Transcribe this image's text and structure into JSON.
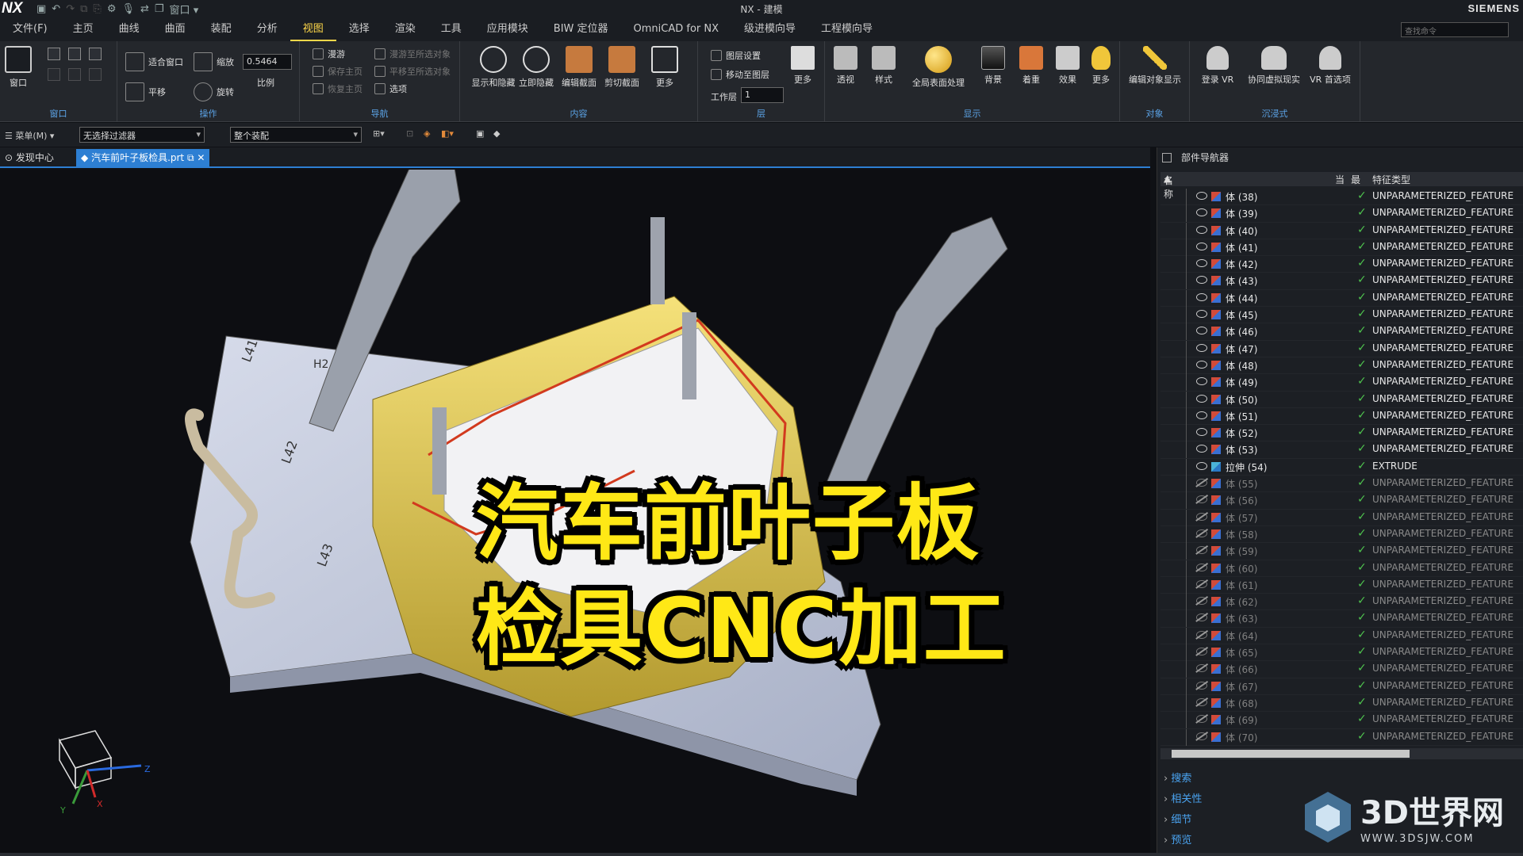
{
  "app": {
    "logo": "NX",
    "title": "NX - 建模",
    "brand": "SIEMENS",
    "window_menu": "窗口"
  },
  "menu": {
    "tabs": [
      "文件(F)",
      "主页",
      "曲线",
      "曲面",
      "装配",
      "分析",
      "视图",
      "选择",
      "渲染",
      "工具",
      "应用模块",
      "BIW 定位器",
      "OmniCAD for NX",
      "级进模向导",
      "工程模向导"
    ],
    "active": "视图",
    "search_placeholder": "查找命令"
  },
  "ribbon": {
    "window_group": {
      "label": "窗口",
      "btn": "窗口"
    },
    "operate_group": {
      "label": "操作",
      "fit": "适合窗口",
      "zoom": "缩放",
      "zoom_value": "0.5464",
      "scale": "比例",
      "pan": "平移",
      "rotate": "旋转"
    },
    "nav_group": {
      "label": "导航",
      "items": [
        "漫游",
        "漫游至所选对象",
        "保存主页",
        "平移至所选对象",
        "恢复主页",
        "选项"
      ]
    },
    "content_group": {
      "label": "内容",
      "items": [
        "显示和隐藏",
        "立即隐藏",
        "编辑截面",
        "剪切截面",
        "更多"
      ]
    },
    "layer_group": {
      "label": "层",
      "items": [
        "图层设置",
        "移动至图层"
      ],
      "work_layer_label": "工作层",
      "work_layer_value": "1",
      "more": "更多"
    },
    "display_group": {
      "label": "显示",
      "items": [
        "透视",
        "样式",
        "全局表面处理",
        "背景",
        "着重",
        "效果",
        "更多"
      ]
    },
    "object_group": {
      "label": "对象",
      "items": [
        "编辑对象显示"
      ]
    },
    "vr_group": {
      "label": "沉浸式",
      "items": [
        "登录 VR",
        "协同虚拟现实",
        "VR 首选项"
      ]
    }
  },
  "filterbar": {
    "menu": "菜单(M)",
    "filter": "无选择过滤器",
    "assembly": "整个装配"
  },
  "doctabs": {
    "discover": "发现中心",
    "active": "汽车前叶子板检具.prt"
  },
  "overlay": {
    "line1": "汽车前叶子板",
    "line2": "检具CNC加工"
  },
  "viewport": {
    "edge_labels": [
      "L41",
      "H2",
      "L42",
      "L43"
    ]
  },
  "axes": {
    "x": "X",
    "y": "Y",
    "z": "Z"
  },
  "navigator": {
    "title": "部件导航器",
    "columns": {
      "name": "名称",
      "current": "当",
      "latest": "最",
      "feature_type": "特征类型"
    },
    "rows": [
      {
        "name": "体 (38)",
        "type": "UNPARAMETERIZED_FEATURE",
        "hidden": false
      },
      {
        "name": "体 (39)",
        "type": "UNPARAMETERIZED_FEATURE",
        "hidden": false
      },
      {
        "name": "体 (40)",
        "type": "UNPARAMETERIZED_FEATURE",
        "hidden": false
      },
      {
        "name": "体 (41)",
        "type": "UNPARAMETERIZED_FEATURE",
        "hidden": false
      },
      {
        "name": "体 (42)",
        "type": "UNPARAMETERIZED_FEATURE",
        "hidden": false
      },
      {
        "name": "体 (43)",
        "type": "UNPARAMETERIZED_FEATURE",
        "hidden": false
      },
      {
        "name": "体 (44)",
        "type": "UNPARAMETERIZED_FEATURE",
        "hidden": false
      },
      {
        "name": "体 (45)",
        "type": "UNPARAMETERIZED_FEATURE",
        "hidden": false
      },
      {
        "name": "体 (46)",
        "type": "UNPARAMETERIZED_FEATURE",
        "hidden": false
      },
      {
        "name": "体 (47)",
        "type": "UNPARAMETERIZED_FEATURE",
        "hidden": false
      },
      {
        "name": "体 (48)",
        "type": "UNPARAMETERIZED_FEATURE",
        "hidden": false
      },
      {
        "name": "体 (49)",
        "type": "UNPARAMETERIZED_FEATURE",
        "hidden": false
      },
      {
        "name": "体 (50)",
        "type": "UNPARAMETERIZED_FEATURE",
        "hidden": false
      },
      {
        "name": "体 (51)",
        "type": "UNPARAMETERIZED_FEATURE",
        "hidden": false
      },
      {
        "name": "体 (52)",
        "type": "UNPARAMETERIZED_FEATURE",
        "hidden": false
      },
      {
        "name": "体 (53)",
        "type": "UNPARAMETERIZED_FEATURE",
        "hidden": false
      },
      {
        "name": "拉伸 (54)",
        "type": "EXTRUDE",
        "hidden": false,
        "ext": true
      },
      {
        "name": "体 (55)",
        "type": "UNPARAMETERIZED_FEATURE",
        "hidden": true
      },
      {
        "name": "体 (56)",
        "type": "UNPARAMETERIZED_FEATURE",
        "hidden": true
      },
      {
        "name": "体 (57)",
        "type": "UNPARAMETERIZED_FEATURE",
        "hidden": true
      },
      {
        "name": "体 (58)",
        "type": "UNPARAMETERIZED_FEATURE",
        "hidden": true
      },
      {
        "name": "体 (59)",
        "type": "UNPARAMETERIZED_FEATURE",
        "hidden": true
      },
      {
        "name": "体 (60)",
        "type": "UNPARAMETERIZED_FEATURE",
        "hidden": true
      },
      {
        "name": "体 (61)",
        "type": "UNPARAMETERIZED_FEATURE",
        "hidden": true
      },
      {
        "name": "体 (62)",
        "type": "UNPARAMETERIZED_FEATURE",
        "hidden": true
      },
      {
        "name": "体 (63)",
        "type": "UNPARAMETERIZED_FEATURE",
        "hidden": true
      },
      {
        "name": "体 (64)",
        "type": "UNPARAMETERIZED_FEATURE",
        "hidden": true
      },
      {
        "name": "体 (65)",
        "type": "UNPARAMETERIZED_FEATURE",
        "hidden": true
      },
      {
        "name": "体 (66)",
        "type": "UNPARAMETERIZED_FEATURE",
        "hidden": true
      },
      {
        "name": "体 (67)",
        "type": "UNPARAMETERIZED_FEATURE",
        "hidden": true
      },
      {
        "name": "体 (68)",
        "type": "UNPARAMETERIZED_FEATURE",
        "hidden": true
      },
      {
        "name": "体 (69)",
        "type": "UNPARAMETERIZED_FEATURE",
        "hidden": true
      },
      {
        "name": "体 (70)",
        "type": "UNPARAMETERIZED_FEATURE",
        "hidden": true
      }
    ],
    "sections": [
      "搜索",
      "相关性",
      "细节",
      "预览"
    ]
  },
  "watermark": {
    "title": "3D世界网",
    "subtitle": "WWW.3DSJW.COM"
  },
  "colors": {
    "accent": "#2d7fd3",
    "active_tab": "#ffd84a",
    "overlay_text": "#ffe816",
    "check": "#4ec34e"
  }
}
